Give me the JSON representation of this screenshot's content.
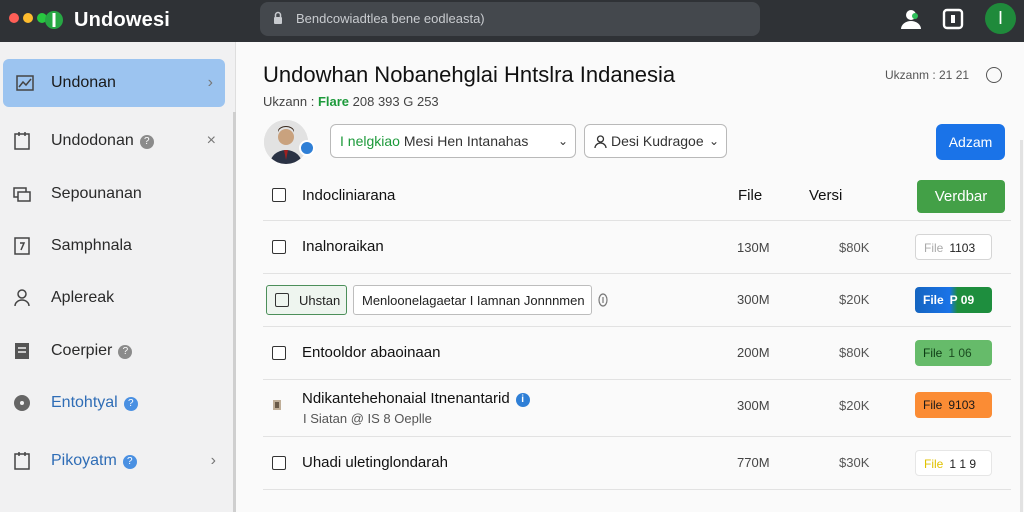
{
  "window": {
    "title": "Undowesi",
    "url": "Bendcowiadtlea bene eodleasta)",
    "dot_colors": [
      "#ff5f57",
      "#febc2e",
      "#28c840"
    ],
    "profile_initial": "I"
  },
  "sidebar": {
    "items": [
      {
        "label": "Undonan",
        "icon": "chart-icon",
        "active": true,
        "trail": "›"
      },
      {
        "label": "Undodonan",
        "icon": "calendar-icon",
        "badge": "?",
        "trail": "×"
      },
      {
        "label": "Sepounanan",
        "icon": "stack-icon"
      },
      {
        "label": "Samphnala",
        "icon": "question-box-icon"
      },
      {
        "label": "Aplereak",
        "icon": "person-icon"
      },
      {
        "label": "Coerpier",
        "icon": "document-icon",
        "badge": "?"
      },
      {
        "label": "Entohtyal",
        "icon": "circle-icon",
        "badge": "?",
        "color": "#2f6db6"
      },
      {
        "label": "Pikoyatm",
        "icon": "calendar-icon",
        "badge": "?",
        "trail": "›",
        "color": "#2f6db6"
      }
    ]
  },
  "header": {
    "title": "Undowhan Nobanehglai Hntslra  Indanesia",
    "sub_prefix": "Ukzann :",
    "sub_green": "Flare",
    "sub_rest": "208  393  G 253",
    "top_right": "Ukzanm : 21 21"
  },
  "toolbar": {
    "select1_green": "I nelgkiao",
    "select1_rest": " Mesi Hen Intanahas",
    "select2": "Desi Kudragoe",
    "primary_button": "Adzam"
  },
  "table": {
    "columns": {
      "name": "Indocliniarana",
      "file": "File",
      "version": "Versi",
      "action": "Verdbar"
    },
    "rows": [
      {
        "name": "Inalnoraikan",
        "size": "130M",
        "ver": "$80K",
        "pill_label": "File",
        "pill_value": "1103",
        "pill_style": "white"
      },
      {
        "chip": "Uhstan",
        "input": "Menloonelagaetar  I  Iamnan Jonnnmen",
        "size": "300M",
        "ver": "$20K",
        "pill_label": "File",
        "pill_value": "P 09",
        "pill_style": "blue"
      },
      {
        "name": "Entooldor abaoinaan",
        "size": "200M",
        "ver": "$80K",
        "pill_label": "File",
        "pill_value": "1 06",
        "pill_style": "lgreen"
      },
      {
        "name": "Ndikantehehonaial Itnenantarid",
        "sub": "I Siatan @ IS 8  Oeplle",
        "size": "300M",
        "ver": "$20K",
        "pill_label": "File",
        "pill_value": "9103",
        "pill_style": "orange",
        "info": "i"
      },
      {
        "name": "Uhadi uletinglondarah",
        "size": "770M",
        "ver": "$30K",
        "pill_label": "File",
        "pill_value": "1 1 9",
        "pill_style": "yellow"
      }
    ]
  }
}
